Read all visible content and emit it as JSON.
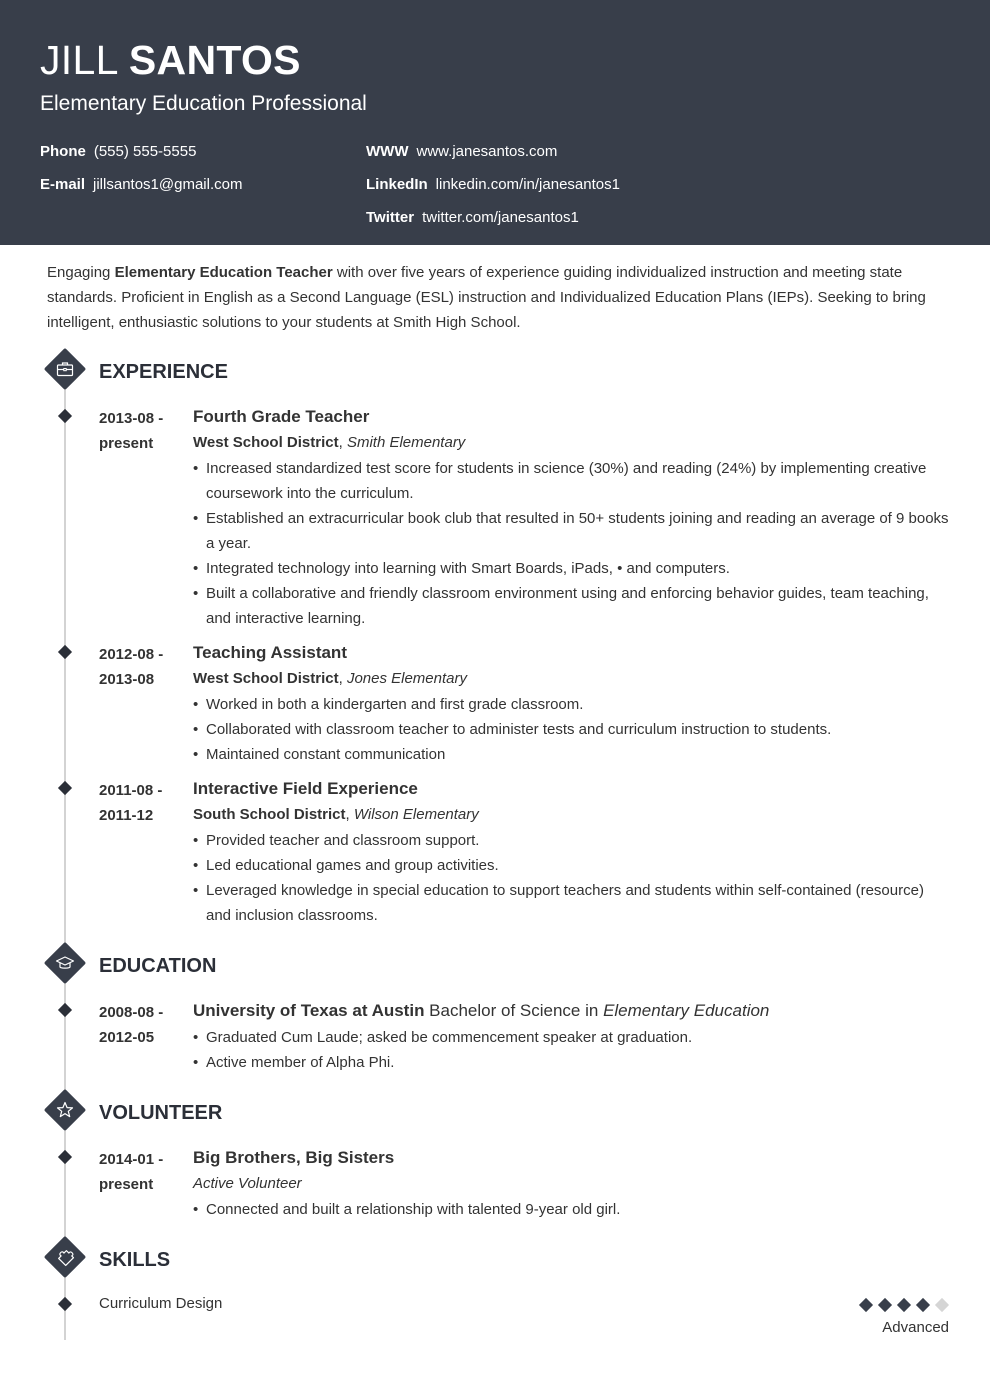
{
  "header": {
    "first_name": "JILL",
    "last_name": "SANTOS",
    "title": "Elementary Education Professional",
    "contacts": [
      {
        "label": "Phone",
        "value": "(555) 555-5555"
      },
      {
        "label": "E-mail",
        "value": "jillsantos1@gmail.com"
      },
      {
        "label": "WWW",
        "value": "www.janesantos.com"
      },
      {
        "label": "LinkedIn",
        "value": "linkedin.com/in/janesantos1"
      },
      {
        "label": "Twitter",
        "value": "twitter.com/janesantos1"
      }
    ],
    "colors": {
      "background": "#383e4a",
      "text": "#ffffff"
    }
  },
  "summary": {
    "prefix": "Engaging ",
    "highlight": "Elementary Education Teacher",
    "suffix": " with over five years of experience guiding individualized instruction and meeting state standards. Proficient in English as a Second Language (ESL) instruction and Individualized Education Plans (IEPs). Seeking to bring intelligent, enthusiastic solutions to your students at Smith High School."
  },
  "sections": {
    "experience": {
      "title": "EXPERIENCE",
      "icon": "briefcase-icon",
      "entries": [
        {
          "date_start": "2013-08 -",
          "date_end": "present",
          "title": "Fourth Grade Teacher",
          "org": "West School District",
          "place": "Smith Elementary",
          "bullets": [
            "Increased standardized test score for students in science (30%) and reading (24%) by implementing creative coursework into the curriculum.",
            "Established an extracurricular book club that resulted in 50+ students joining and reading an average of 9 books a year.",
            "Integrated technology into learning with Smart Boards, iPads, • and computers.",
            "Built a collaborative and friendly classroom environment using and enforcing behavior guides, team teaching, and interactive learning."
          ]
        },
        {
          "date_start": "2012-08 -",
          "date_end": "2013-08",
          "title": "Teaching Assistant",
          "org": "West School District",
          "place": "Jones Elementary",
          "bullets": [
            "Worked in both a kindergarten and first grade classroom.",
            "Collaborated with classroom teacher to administer tests and curriculum instruction to students.",
            "Maintained constant communication"
          ]
        },
        {
          "date_start": "2011-08 -",
          "date_end": "2011-12",
          "title": "Interactive Field Experience",
          "org": "South School District",
          "place": "Wilson Elementary",
          "bullets": [
            "Provided teacher and classroom support.",
            "Led educational games and group activities.",
            "Leveraged knowledge in special education to support teachers and students within self-contained (resource) and inclusion classrooms."
          ]
        }
      ]
    },
    "education": {
      "title": "EDUCATION",
      "icon": "graduation-cap-icon",
      "entries": [
        {
          "date_start": "2008-08 -",
          "date_end": "2012-05",
          "school": "University of Texas at Austin",
          "degree": " Bachelor of Science in ",
          "field": "Elementary Education",
          "bullets": [
            "Graduated Cum Laude; asked be commencement speaker at graduation.",
            "Active member of Alpha Phi."
          ]
        }
      ]
    },
    "volunteer": {
      "title": "VOLUNTEER",
      "icon": "star-icon",
      "entries": [
        {
          "date_start": "2014-01 -",
          "date_end": "present",
          "title": "Big Brothers, Big Sisters",
          "role": "Active Volunteer",
          "bullets": [
            "Connected and built a relationship with talented 9-year old girl."
          ]
        }
      ]
    },
    "skills": {
      "title": "SKILLS",
      "icon": "puzzle-piece-icon",
      "items": [
        {
          "name": "Curriculum Design",
          "rating": 4,
          "max_rating": 5,
          "level": "Advanced"
        }
      ]
    }
  }
}
